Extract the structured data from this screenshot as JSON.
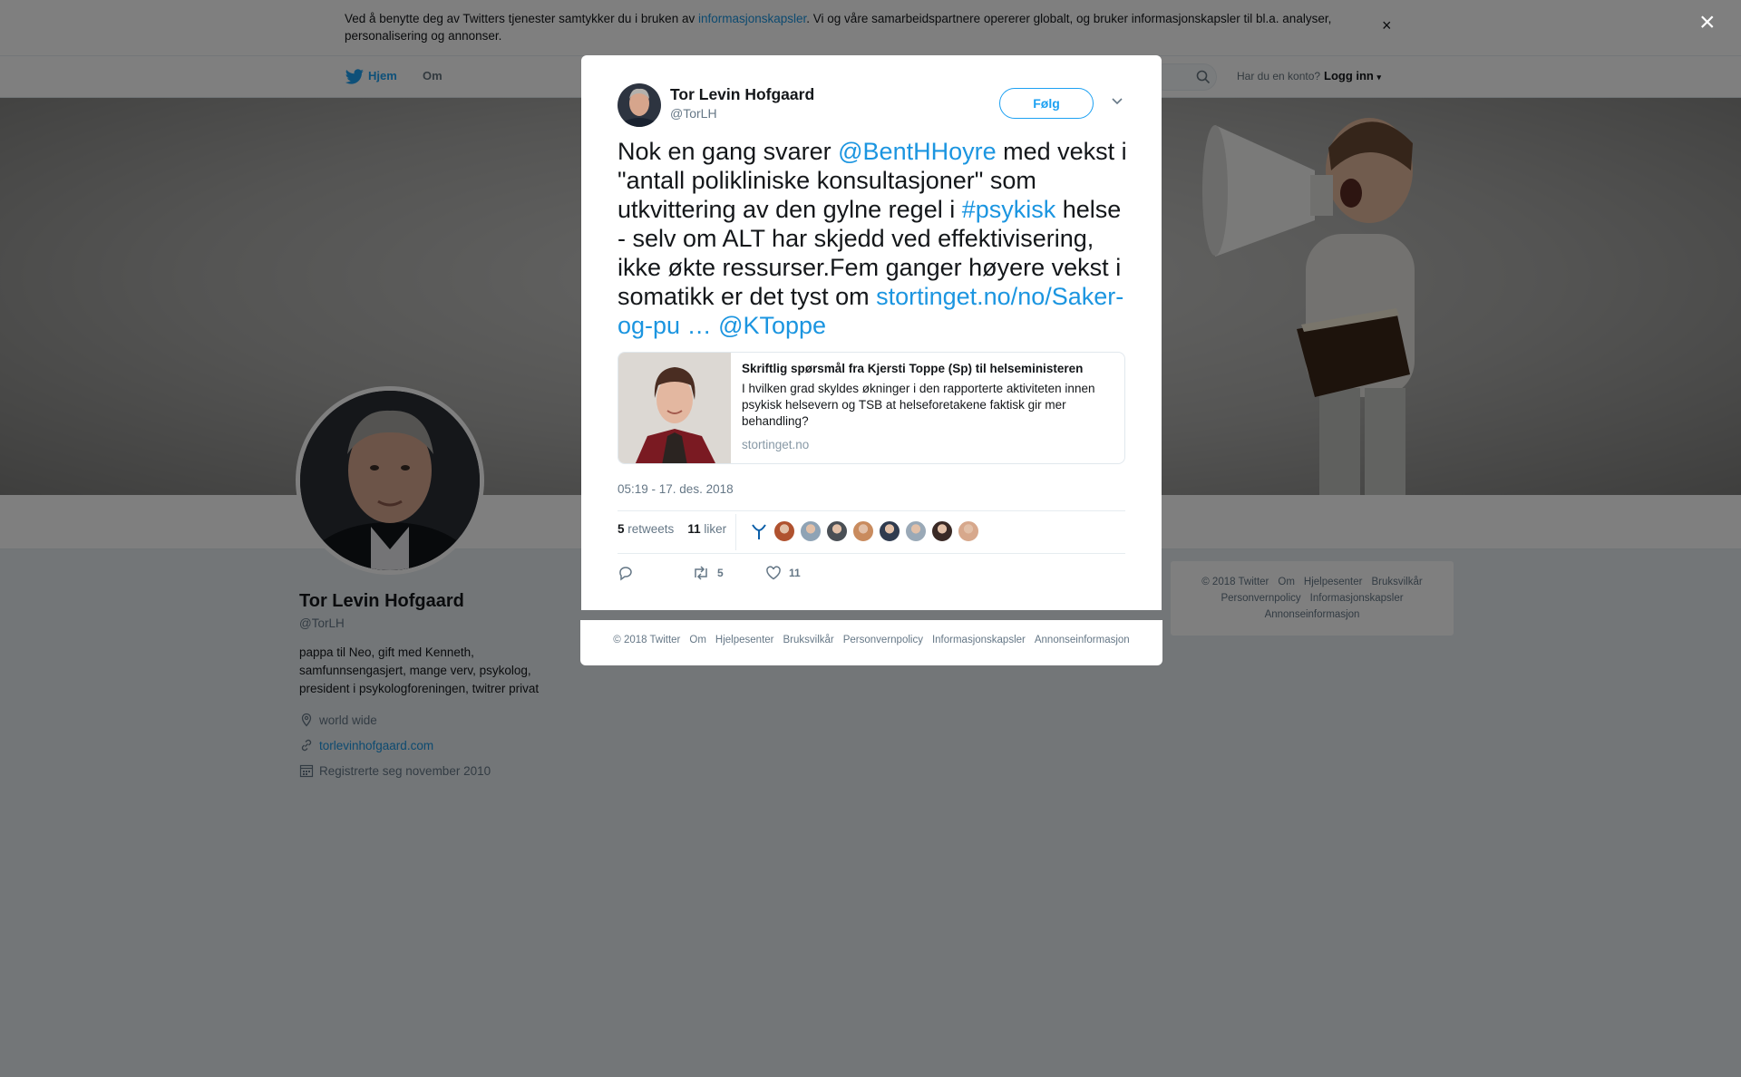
{
  "cookie_bar": {
    "text_before": "Ved å benytte deg av Twitters tjenester samtykker du i bruken av ",
    "link": "informasjonskapsler",
    "text_after": ". Vi og våre samarbeidspartnere opererer globalt, og bruker informasjonskapsler til bl.a. analyser, personalisering og annonser.",
    "close": "×"
  },
  "nav": {
    "home": "Hjem",
    "about": "Om",
    "account_prompt": "Har du en konto?",
    "login": "Logg inn"
  },
  "profile": {
    "name": "Tor Levin Hofgaard",
    "handle": "@TorLH",
    "bio": "pappa til Neo, gift med Kenneth, samfunnsengasjert, mange verv, psykolog, president i psykologforeningen, twitrer privat",
    "location": "world wide",
    "website": "torlevinhofgaard.com",
    "joined": "Registrerte seg november 2010"
  },
  "side_footer": {
    "links": [
      "© 2018 Twitter",
      "Om",
      "Hjelpesenter",
      "Bruksvilkår",
      "Personvernpolicy",
      "Informasjonskapsler",
      "Annonseinformasjon"
    ]
  },
  "overlay": {
    "close": "×"
  },
  "tweet": {
    "author_name": "Tor Levin Hofgaard",
    "author_handle": "@TorLH",
    "follow_label": "Følg",
    "text": {
      "t1": "Nok en gang svarer ",
      "mention1": "@BentHHoyre",
      "t2": " med vekst i \"antall polikliniske konsultasjoner\" som utkvittering av den gylne regel i ",
      "hashtag": "#psykisk",
      "t3": " helse - selv om ALT har skjedd ved effektivisering, ikke økte ressurser.Fem ganger høyere vekst i somatikk er det tyst om ",
      "url": "stortinget.no/no/Saker-og-pu",
      "ellipsis": " … ",
      "mention2": "@KToppe"
    },
    "card": {
      "title": "Skriftlig spørsmål fra Kjersti Toppe (Sp) til helseministeren",
      "description": "I hvilken grad skyldes økninger i den rapporterte aktiviteten innen psykisk helsevern og TSB at helseforetakene faktisk gir mer behandling?",
      "domain": "stortinget.no"
    },
    "timestamp": "05:19 - 17. des. 2018",
    "retweets_count": "5",
    "retweets_label": "retweets",
    "likes_count": "11",
    "likes_label": "liker",
    "action_retweet_count": "5",
    "action_like_count": "11",
    "liker_avatar_colors": [
      "#b0522f",
      "#8fa3b5",
      "#4a4f55",
      "#c98b5e",
      "#2f3b4f",
      "#9aa9b7",
      "#3a2a26",
      "#d7a88c"
    ]
  },
  "modal_footer": {
    "links": [
      "© 2018 Twitter",
      "Om",
      "Hjelpesenter",
      "Bruksvilkår",
      "Personvernpolicy",
      "Informasjonskapsler",
      "Annonseinformasjon"
    ]
  },
  "colors": {
    "accent": "#1da1f2",
    "link": "#1b95e0",
    "secondary_text": "#657786"
  }
}
